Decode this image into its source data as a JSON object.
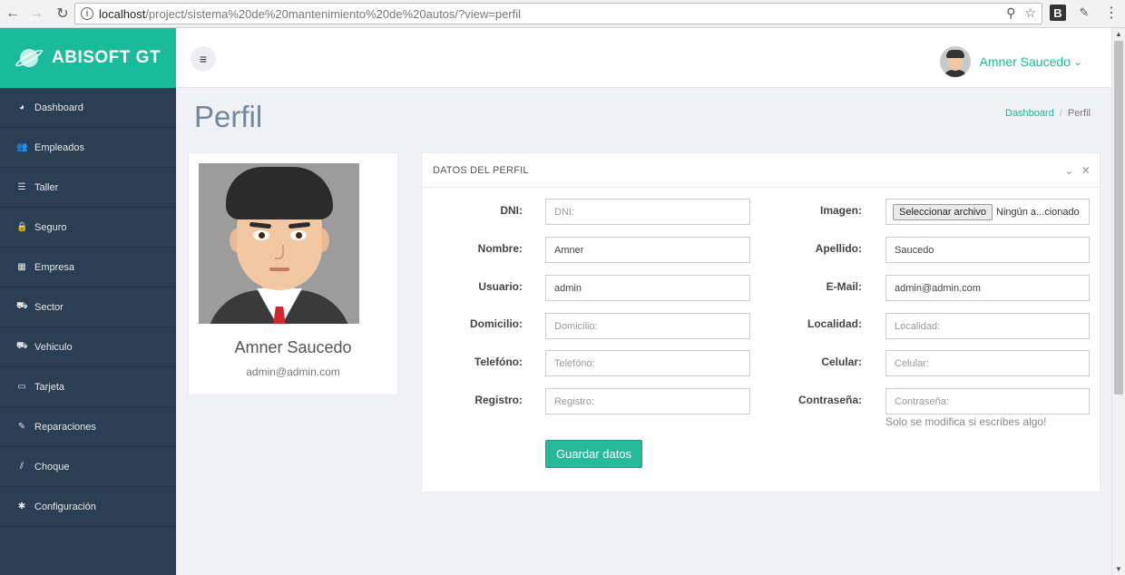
{
  "browser": {
    "url_host": "localhost",
    "url_path": "/project/sistema%20de%20mantenimiento%20de%20autos/?view=perfil",
    "ext_b": "B"
  },
  "brand": {
    "title": "ABISOFT GT"
  },
  "sidebar": {
    "items": [
      {
        "label": "Dashboard",
        "icon": "dashboard-icon",
        "glyph": "◕"
      },
      {
        "label": "Empleados",
        "icon": "users-icon",
        "glyph": "👥"
      },
      {
        "label": "Taller",
        "icon": "list-icon",
        "glyph": "☰"
      },
      {
        "label": "Seguro",
        "icon": "lock-icon",
        "glyph": "🔒"
      },
      {
        "label": "Empresa",
        "icon": "building-icon",
        "glyph": "▦"
      },
      {
        "label": "Sector",
        "icon": "binoculars-icon",
        "glyph": "⛟"
      },
      {
        "label": "Vehiculo",
        "icon": "truck-icon",
        "glyph": "⛟"
      },
      {
        "label": "Tarjeta",
        "icon": "credit-card-icon",
        "glyph": "▭"
      },
      {
        "label": "Reparaciones",
        "icon": "wrench-icon",
        "glyph": "✎"
      },
      {
        "label": "Choque",
        "icon": "road-icon",
        "glyph": "⫽"
      },
      {
        "label": "Configuración",
        "icon": "gear-icon",
        "glyph": "✱"
      }
    ]
  },
  "topnav": {
    "user_name": "Amner Saucedo",
    "caret": "⌄"
  },
  "page": {
    "title": "Perfil",
    "breadcrumb": {
      "home": "Dashboard",
      "separator": "/",
      "current": "Perfil"
    }
  },
  "profile": {
    "name": "Amner Saucedo",
    "email": "admin@admin.com"
  },
  "panel": {
    "title": "DATOS DEL PERFIL",
    "fields_left": [
      {
        "label": "DNI:",
        "value": "",
        "placeholder": "DNI:"
      },
      {
        "label": "Nombre:",
        "value": "Amner",
        "placeholder": ""
      },
      {
        "label": "Usuario:",
        "value": "admin",
        "placeholder": ""
      },
      {
        "label": "Domicilio:",
        "value": "",
        "placeholder": "Domicilio:"
      },
      {
        "label": "Telefóno:",
        "value": "",
        "placeholder": "Telefóno:"
      },
      {
        "label": "Registro:",
        "value": "",
        "placeholder": "Registro:"
      }
    ],
    "fields_right": [
      {
        "label": "Imagen:",
        "button": "Seleccionar archivo",
        "file_text": "Ningún a...cionado"
      },
      {
        "label": "Apellido:",
        "value": "Saucedo",
        "placeholder": ""
      },
      {
        "label": "E-Mail:",
        "value": "admin@admin.com",
        "placeholder": ""
      },
      {
        "label": "Localidad:",
        "value": "",
        "placeholder": "Localidad:"
      },
      {
        "label": "Celular:",
        "value": "",
        "placeholder": "Celular:"
      },
      {
        "label": "Contraseña:",
        "value": "",
        "placeholder": "Contraseña:"
      }
    ],
    "password_hint": "Solo se modifica si escribes algo!",
    "save_label": "Guardar datos"
  },
  "colors": {
    "accent": "#1abb9c",
    "sidebar_bg": "#2a3f54",
    "button": "#26b99a"
  }
}
